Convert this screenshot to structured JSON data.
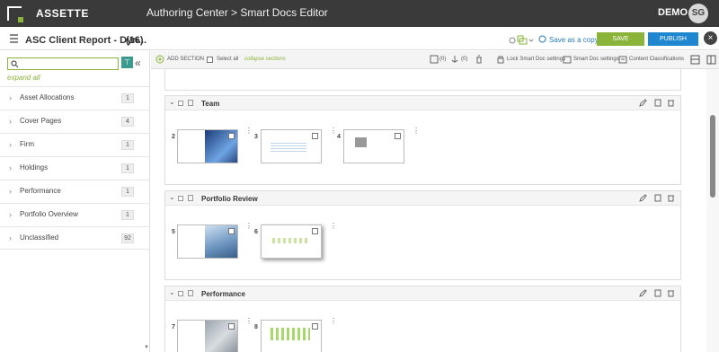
{
  "topbar": {
    "brand": "ASSETTE",
    "title": "Authoring Center > Smart Docs Editor",
    "user": "DEMO",
    "initials": "SG"
  },
  "header": {
    "doc_title": "ASC Client Report - Dyn...",
    "count": "(16)",
    "save_copy": "Save as a copy",
    "save": "SAVE",
    "publish": "PUBLISH"
  },
  "sidebar": {
    "expand_all": "expand all",
    "categories": [
      {
        "label": "Asset Allocations",
        "count": "1"
      },
      {
        "label": "Cover Pages",
        "count": "4"
      },
      {
        "label": "Firm",
        "count": "1"
      },
      {
        "label": "Holdings",
        "count": "1"
      },
      {
        "label": "Performance",
        "count": "1"
      },
      {
        "label": "Portfolio Overview",
        "count": "1"
      },
      {
        "label": "Unclassified",
        "count": "92"
      }
    ]
  },
  "toolbar": {
    "add_section": "ADD SECTION",
    "select_all": "Select all",
    "collapse": "collapse sections",
    "c1": "(0)",
    "c2": "(0)",
    "lock": "Lock Smart Doc settings",
    "settings": "Smart Doc settings",
    "classifications": "Content Classifications"
  },
  "sections": [
    {
      "title": "Team",
      "pages": [
        "2",
        "3",
        "4"
      ]
    },
    {
      "title": "Portfolio Review",
      "pages": [
        "5",
        "6"
      ]
    },
    {
      "title": "Performance",
      "pages": [
        "7",
        "8"
      ]
    }
  ],
  "colors": {
    "accent": "#8ab43a",
    "publish": "#1f87cf",
    "topbar": "#3a3a3a"
  }
}
